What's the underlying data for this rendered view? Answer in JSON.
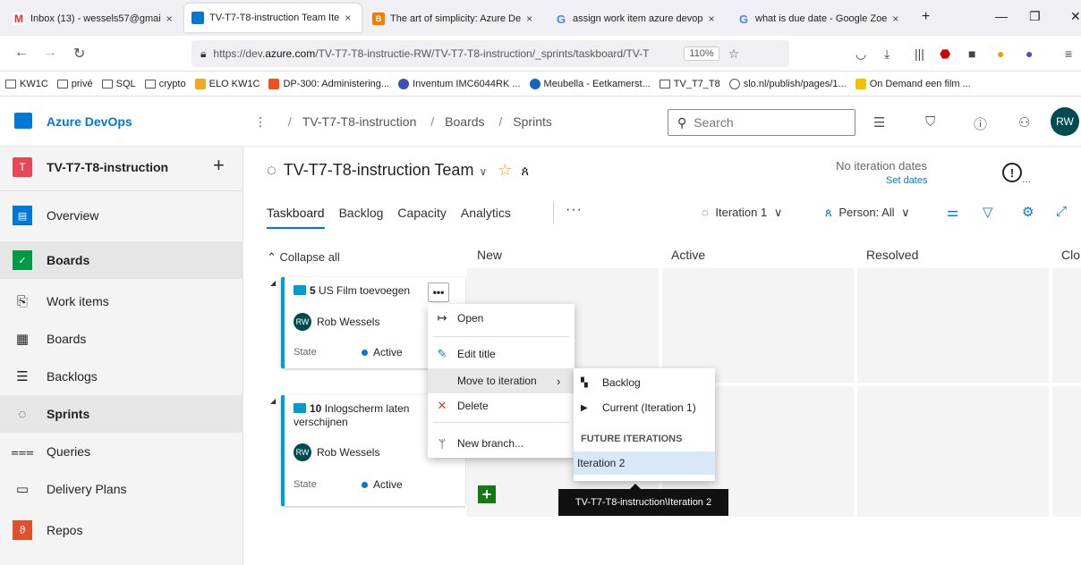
{
  "browser": {
    "tabs": [
      {
        "label": "Inbox (13) - wessels57@gmai",
        "icon": "gmail-icon",
        "color": "#d93025"
      },
      {
        "label": "TV-T7-T8-instruction Team Ite",
        "icon": "azure-devops-icon",
        "color": "#0078d4"
      },
      {
        "label": "The art of simplicity: Azure De",
        "icon": "blogger-icon",
        "color": "#f57c00"
      },
      {
        "label": "assign work item azure devop",
        "icon": "google-icon",
        "color": "#4285f4"
      },
      {
        "label": "what is due date - Google Zoe",
        "icon": "google-icon",
        "color": "#4285f4"
      }
    ],
    "new_tab": "+",
    "url_prefix": "https://dev.",
    "url_domain": "azure.com",
    "url_rest": "/TV-T7-T8-instructie-RW/TV-T7-T8-instruction/_sprints/taskboard/TV-T",
    "zoom": "110%",
    "bookmarks": [
      {
        "label": "KW1C",
        "type": "folder"
      },
      {
        "label": "privé",
        "type": "folder"
      },
      {
        "label": "SQL",
        "type": "folder"
      },
      {
        "label": "crypto",
        "type": "folder"
      },
      {
        "label": "ELO KW1C",
        "type": "site",
        "color": "#f5a623"
      },
      {
        "label": "DP-300: Administering...",
        "type": "site",
        "color": "#f25022"
      },
      {
        "label": "Inventum IMC6044RK ...",
        "type": "site",
        "color": "#3f51b5"
      },
      {
        "label": "Meubella - Eetkamerst...",
        "type": "site",
        "color": "#1565c0"
      },
      {
        "label": "TV_T7_T8",
        "type": "folder"
      },
      {
        "label": "slo.nl/publish/pages/1...",
        "type": "site",
        "color": "#555555"
      },
      {
        "label": "On Demand een film ...",
        "type": "site",
        "color": "#f2c200"
      }
    ]
  },
  "ado": {
    "brand": "Azure DevOps",
    "breadcrumb": [
      "TV-T7-T8-instruction",
      "Boards",
      "Sprints"
    ],
    "search_placeholder": "Search",
    "user_initials": "RW"
  },
  "sidebar": {
    "project_initial": "T",
    "project_name": "TV-T7-T8-instruction",
    "items": [
      {
        "label": "Overview",
        "icon": "overview-icon"
      },
      {
        "label": "Boards",
        "icon": "boards-icon"
      },
      {
        "label": "Work items",
        "icon": "work-items-icon"
      },
      {
        "label": "Boards",
        "icon": "board-icon"
      },
      {
        "label": "Backlogs",
        "icon": "backlogs-icon"
      },
      {
        "label": "Sprints",
        "icon": "sprints-icon"
      },
      {
        "label": "Queries",
        "icon": "queries-icon"
      },
      {
        "label": "Delivery Plans",
        "icon": "delivery-plans-icon"
      },
      {
        "label": "Repos",
        "icon": "repos-icon"
      }
    ]
  },
  "main": {
    "team_title": "TV-T7-T8-instruction Team",
    "iteration_dates": "No iteration dates",
    "set_dates": "Set dates",
    "pivots": [
      "Taskboard",
      "Backlog",
      "Capacity",
      "Analytics"
    ],
    "iteration_filter": "Iteration 1",
    "person_filter": "Person: All",
    "collapse_all": "Collapse all",
    "columns": [
      "New",
      "Active",
      "Resolved",
      "Clo"
    ]
  },
  "cards": [
    {
      "id": "5",
      "title": "US Film toevoegen",
      "owner": "Rob Wessels",
      "owner_initials": "RW",
      "state_label": "State",
      "state": "Active"
    },
    {
      "id": "10",
      "title": "Inlogscherm laten verschijnen",
      "owner": "Rob Wessels",
      "owner_initials": "RW",
      "state_label": "State",
      "state": "Active"
    }
  ],
  "context_menu": {
    "items": [
      "Open",
      "Edit title",
      "Move to iteration",
      "Delete",
      "New branch..."
    ]
  },
  "submenu": {
    "backlog": "Backlog",
    "current": "Current (Iteration 1)",
    "future_header": "FUTURE ITERATIONS",
    "iteration2": "Iteration 2"
  },
  "tooltip": "TV-T7-T8-instruction\\Iteration 2",
  "colors": {
    "accent": "#0078d4",
    "card_border": "#009ccc",
    "add_button": "#107c10"
  }
}
